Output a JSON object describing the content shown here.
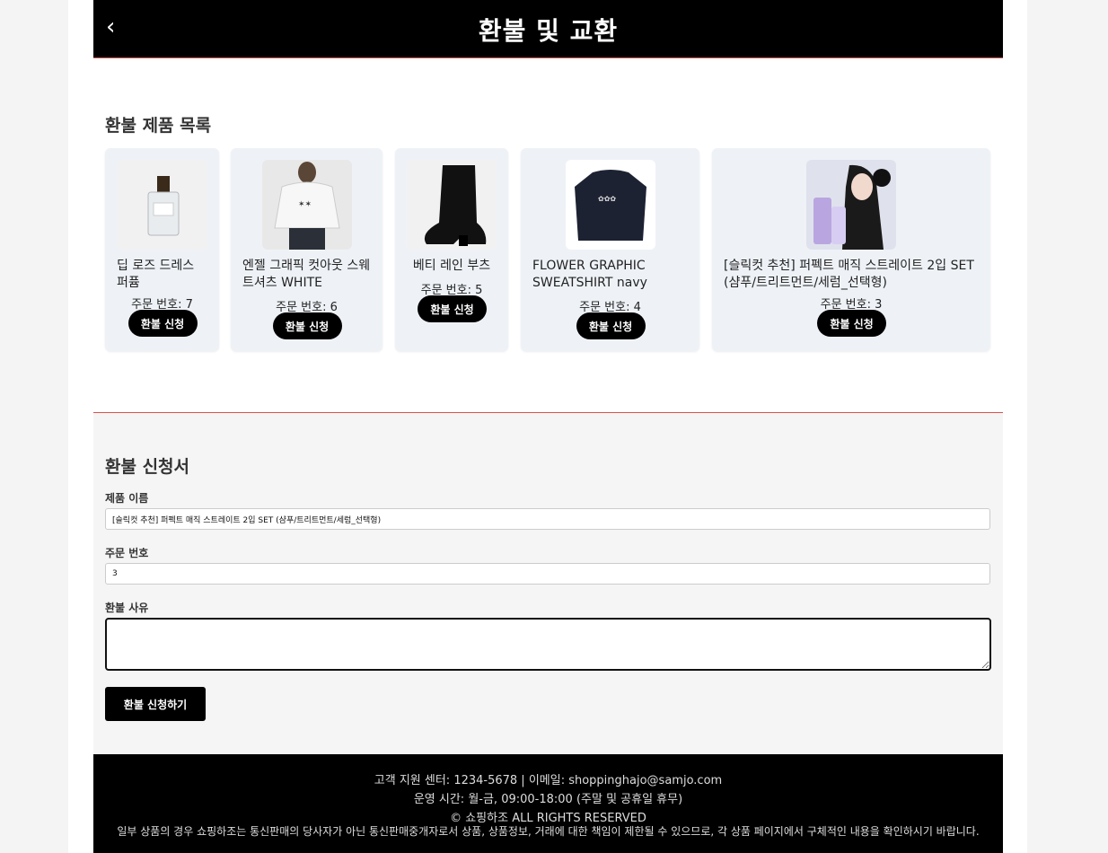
{
  "header": {
    "title": "환불 및 교환",
    "back_icon": "‹"
  },
  "product_list": {
    "title": "환불 제품 목록",
    "order_label": "주문 번호:",
    "button_label": "환불 신청",
    "items": [
      {
        "name": "딥 로즈 드레스 퍼퓸",
        "order_no": "주문 번호: 7",
        "image": "perfume-bottle"
      },
      {
        "name": "엔젤 그래픽 컷아웃 스웨트셔츠 WHITE",
        "order_no": "주문 번호: 6",
        "image": "white-sweatshirt-model"
      },
      {
        "name": "베티 레인 부츠",
        "order_no": "주문 번호: 5",
        "image": "black-rain-boot"
      },
      {
        "name": "FLOWER GRAPHIC SWEATSHIRT navy",
        "order_no": "주문 번호: 4",
        "image": "navy-sweatshirt"
      },
      {
        "name": "[슬릭컷 추천] 퍼펙트 매직 스트레이트 2입 SET (샴푸/트리트먼트/세럼_선택형)",
        "order_no": "주문 번호: 3",
        "image": "haircare-set-model"
      }
    ]
  },
  "form": {
    "title": "환불 신청서",
    "product_name_label": "제품 이름",
    "product_name_value": "[슬릭컷 추천] 퍼펙트 매직 스트레이트 2입 SET (샴푸/트리트먼트/세럼_선택형)",
    "order_no_label": "주문 번호",
    "order_no_value": "3",
    "reason_label": "환불 사유",
    "reason_value": "",
    "submit_label": "환불 신청하기"
  },
  "footer": {
    "support": "고객 지원 센터: 1234-5678 | 이메일: shoppinghajo@samjo.com",
    "hours": "운영 시간: 월-금, 09:00-18:00 (주말 및 공휴일 휴무)",
    "copyright": "© 쇼핑하조 ALL RIGHTS RESERVED",
    "notice": "일부 상품의 경우 쇼핑하조는 통신판매의 당사자가 아닌 통신판매중개자로서 상품, 상품정보, 거래에 대한 책임이 제한될 수 있으므로, 각 상품 페이지에서 구체적인 내용을 확인하시기 바랍니다."
  },
  "colors": {
    "accent_line": "#d9534f",
    "header_bg": "#000000",
    "card_bg": "#eef2f7"
  }
}
